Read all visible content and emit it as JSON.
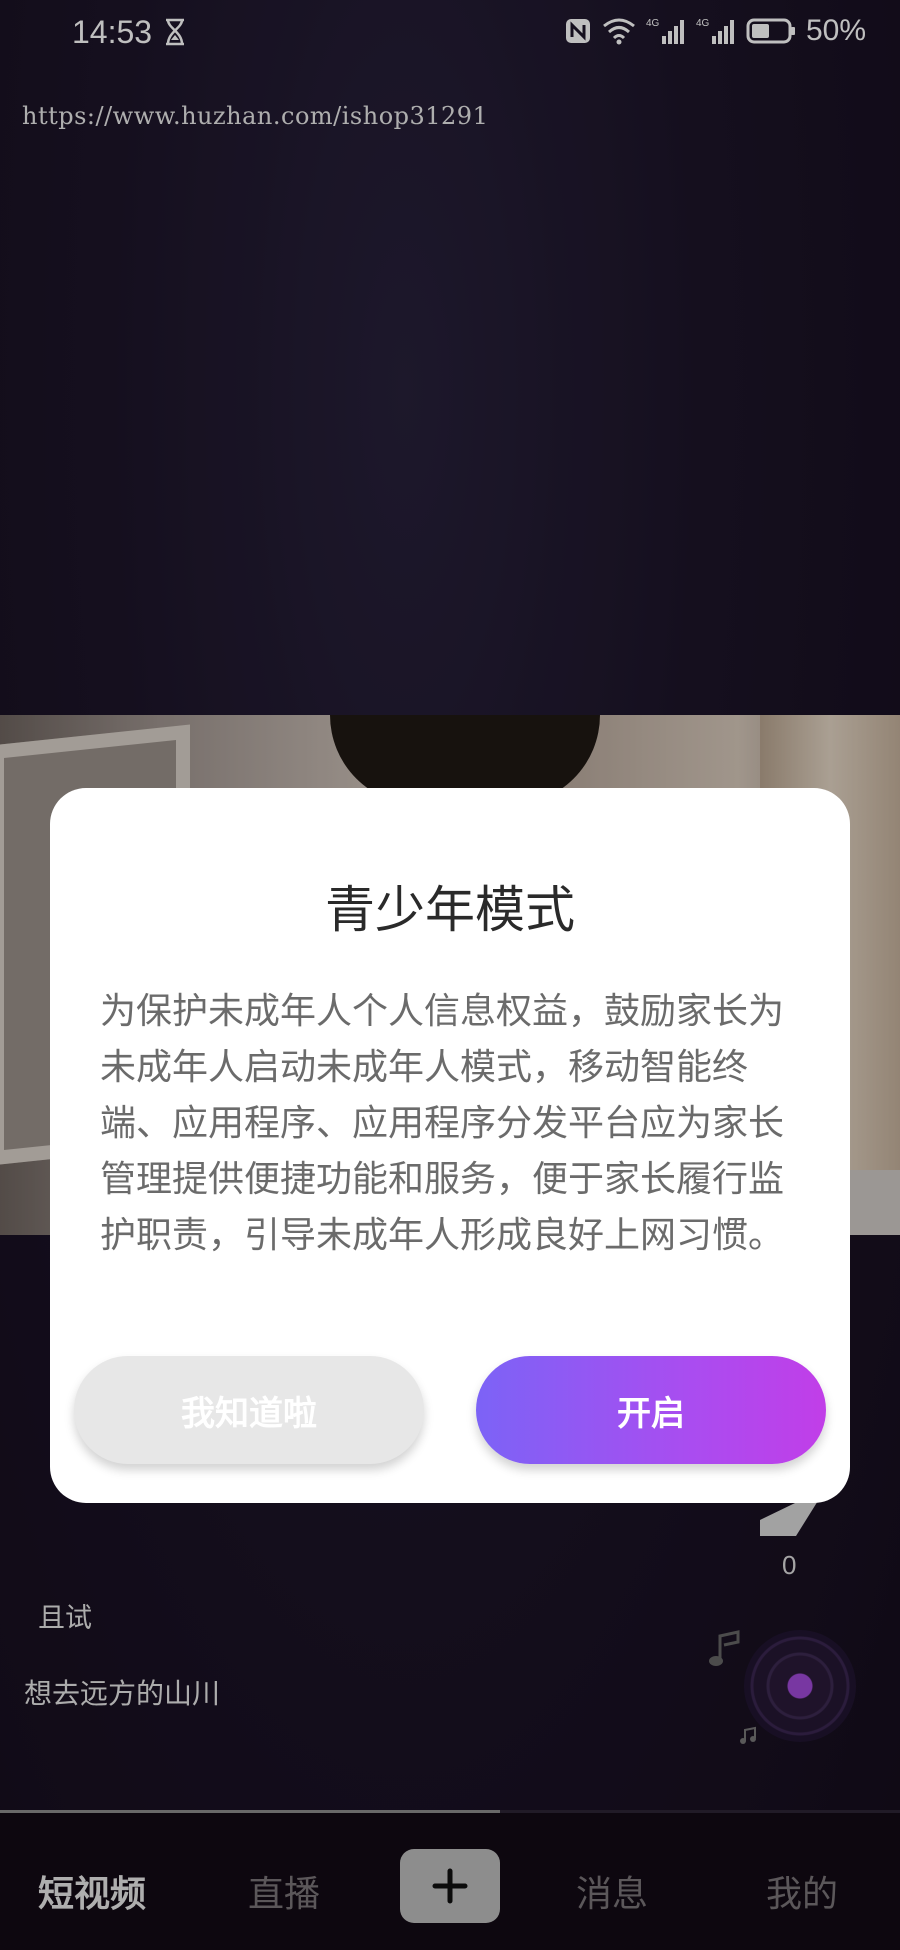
{
  "status_bar": {
    "time": "14:53",
    "battery": "50%",
    "network_label": "4G"
  },
  "url_watermark": "https://www.huzhan.com/ishop31291",
  "video": {
    "author": "且试",
    "caption": "想去远方的山川",
    "share_count": "0",
    "progress_fraction": 0.555
  },
  "dialog": {
    "title": "青少年模式",
    "body": "为保护未成年人个人信息权益，鼓励家长为未成年人启动未成年人模式，移动智能终端、应用程序、应用程序分发平台应为家长管理提供便捷功能和服务，便于家长履行监护职责，引导未成年人形成良好上网习惯。",
    "dismiss_label": "我知道啦",
    "enable_label": "开启"
  },
  "bottom_nav": {
    "short_video": "短视频",
    "live": "直播",
    "add": "+",
    "messages": "消息",
    "mine": "我的"
  },
  "colors": {
    "accent_start": "#7c63f6",
    "accent_end": "#c13ee8"
  }
}
